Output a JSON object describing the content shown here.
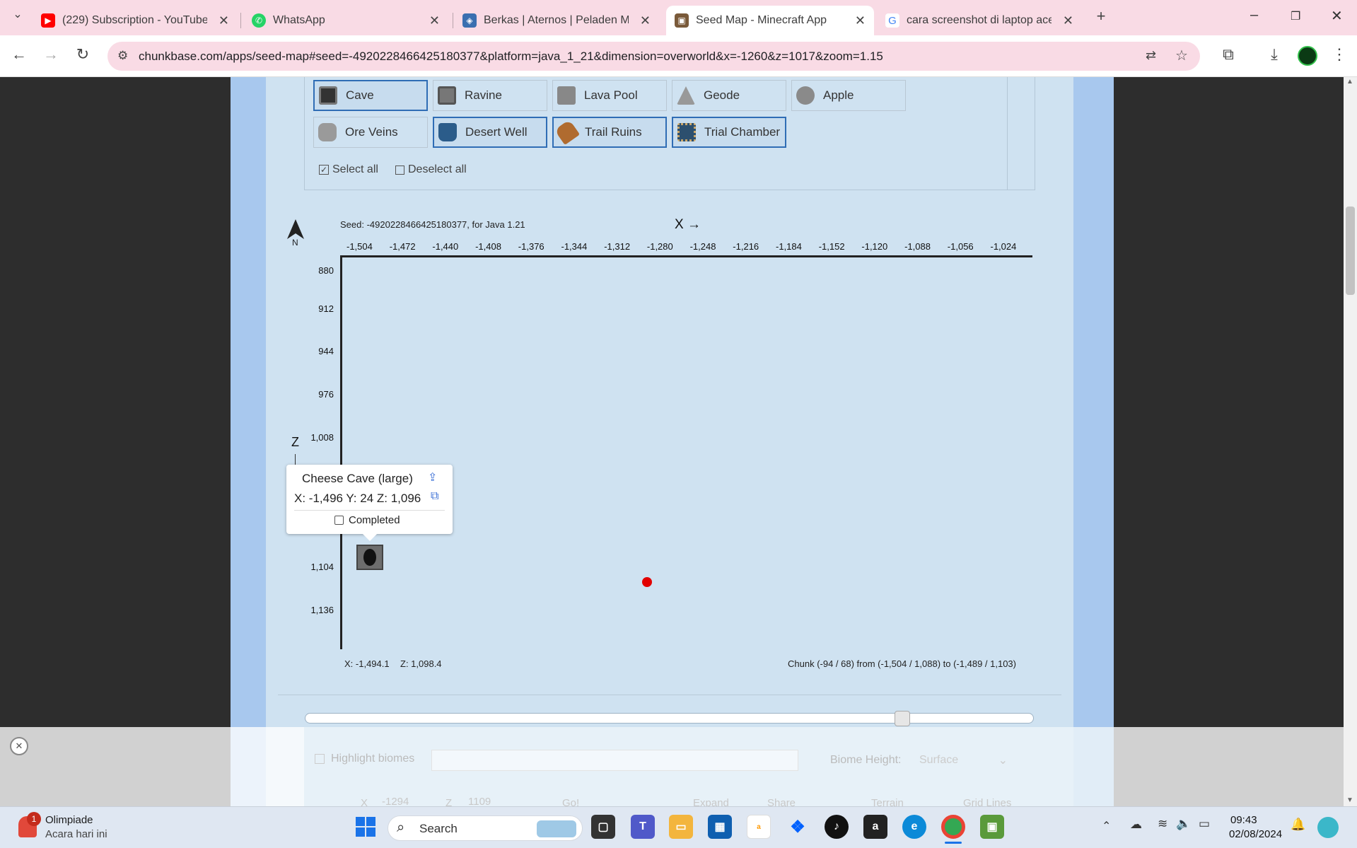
{
  "browser": {
    "tabs": [
      {
        "title": "(229) Subscription - YouTube",
        "icon": "youtube-icon",
        "color": "#ff0000"
      },
      {
        "title": "WhatsApp",
        "icon": "whatsapp-icon",
        "color": "#25d366"
      },
      {
        "title": "Berkas | Aternos | Peladen Mine",
        "icon": "aternos-icon",
        "color": "#3a6fb0"
      },
      {
        "title": "Seed Map - Minecraft App",
        "icon": "chunkbase-icon",
        "color": "#7a5a3a"
      },
      {
        "title": "cara screenshot di laptop acer",
        "icon": "google-icon",
        "color": "#4285f4"
      }
    ],
    "url": "chunkbase.com/apps/seed-map#seed=-4920228466425180377&platform=java_1_21&dimension=overworld&x=-1260&z=1017&zoom=1.15"
  },
  "features": [
    {
      "label": "Cave",
      "selected": true,
      "icon": "cave-icon"
    },
    {
      "label": "Ravine",
      "selected": false,
      "icon": "ravine-icon"
    },
    {
      "label": "Lava Pool",
      "selected": false,
      "icon": "lava-pool-icon"
    },
    {
      "label": "Geode",
      "selected": false,
      "icon": "geode-icon"
    },
    {
      "label": "Apple",
      "selected": false,
      "icon": "apple-icon"
    },
    {
      "label": "Ore Veins",
      "selected": false,
      "icon": "ore-veins-icon"
    },
    {
      "label": "Desert Well",
      "selected": true,
      "icon": "desert-well-icon"
    },
    {
      "label": "Trail Ruins",
      "selected": true,
      "icon": "trail-ruins-icon"
    },
    {
      "label": "Trial Chamber",
      "selected": true,
      "icon": "trial-chamber-icon"
    }
  ],
  "select_all": "Select all",
  "deselect_all": "Deselect all",
  "map": {
    "seed_info": "Seed: -4920228466425180377, for Java 1.21",
    "x_axis_label": "X →",
    "z_axis_label": "Z",
    "north": "N",
    "x_ticks": [
      "-1,504",
      "-1,472",
      "-1,440",
      "-1,408",
      "-1,376",
      "-1,344",
      "-1,312",
      "-1,280",
      "-1,248",
      "-1,216",
      "-1,184",
      "-1,152",
      "-1,120",
      "-1,088",
      "-1,056",
      "-1,024"
    ],
    "z_ticks": [
      "880",
      "912",
      "944",
      "976",
      "1,008",
      "1,104",
      "1,136"
    ],
    "cursor_x": "X: -1,494.1",
    "cursor_z": "Z: 1,098.4",
    "chunk_info": "Chunk (-94 / 68) from (-1,504 / 1,088) to (-1,489 / 1,103)"
  },
  "popup": {
    "title": "Cheese Cave (large)",
    "coords": "X: -1,496 Y: 24 Z: 1,096",
    "completed_label": "Completed"
  },
  "overlay": {
    "highlight_biomes": "Highlight biomes",
    "biome_height_label": "Biome Height:",
    "biome_height_value": "Surface",
    "x_label": "X",
    "x_value": "-1294",
    "z_label": "Z",
    "z_value": "1109",
    "go": "Go!",
    "expand": "Expand",
    "share": "Share",
    "terrain": "Terrain",
    "grid_lines": "Grid Lines"
  },
  "taskbar": {
    "weather_title": "Olimpiade",
    "weather_sub": "Acara hari ini",
    "weather_badge": "1",
    "search": "Search",
    "time": "09:43",
    "date": "02/08/2024"
  }
}
